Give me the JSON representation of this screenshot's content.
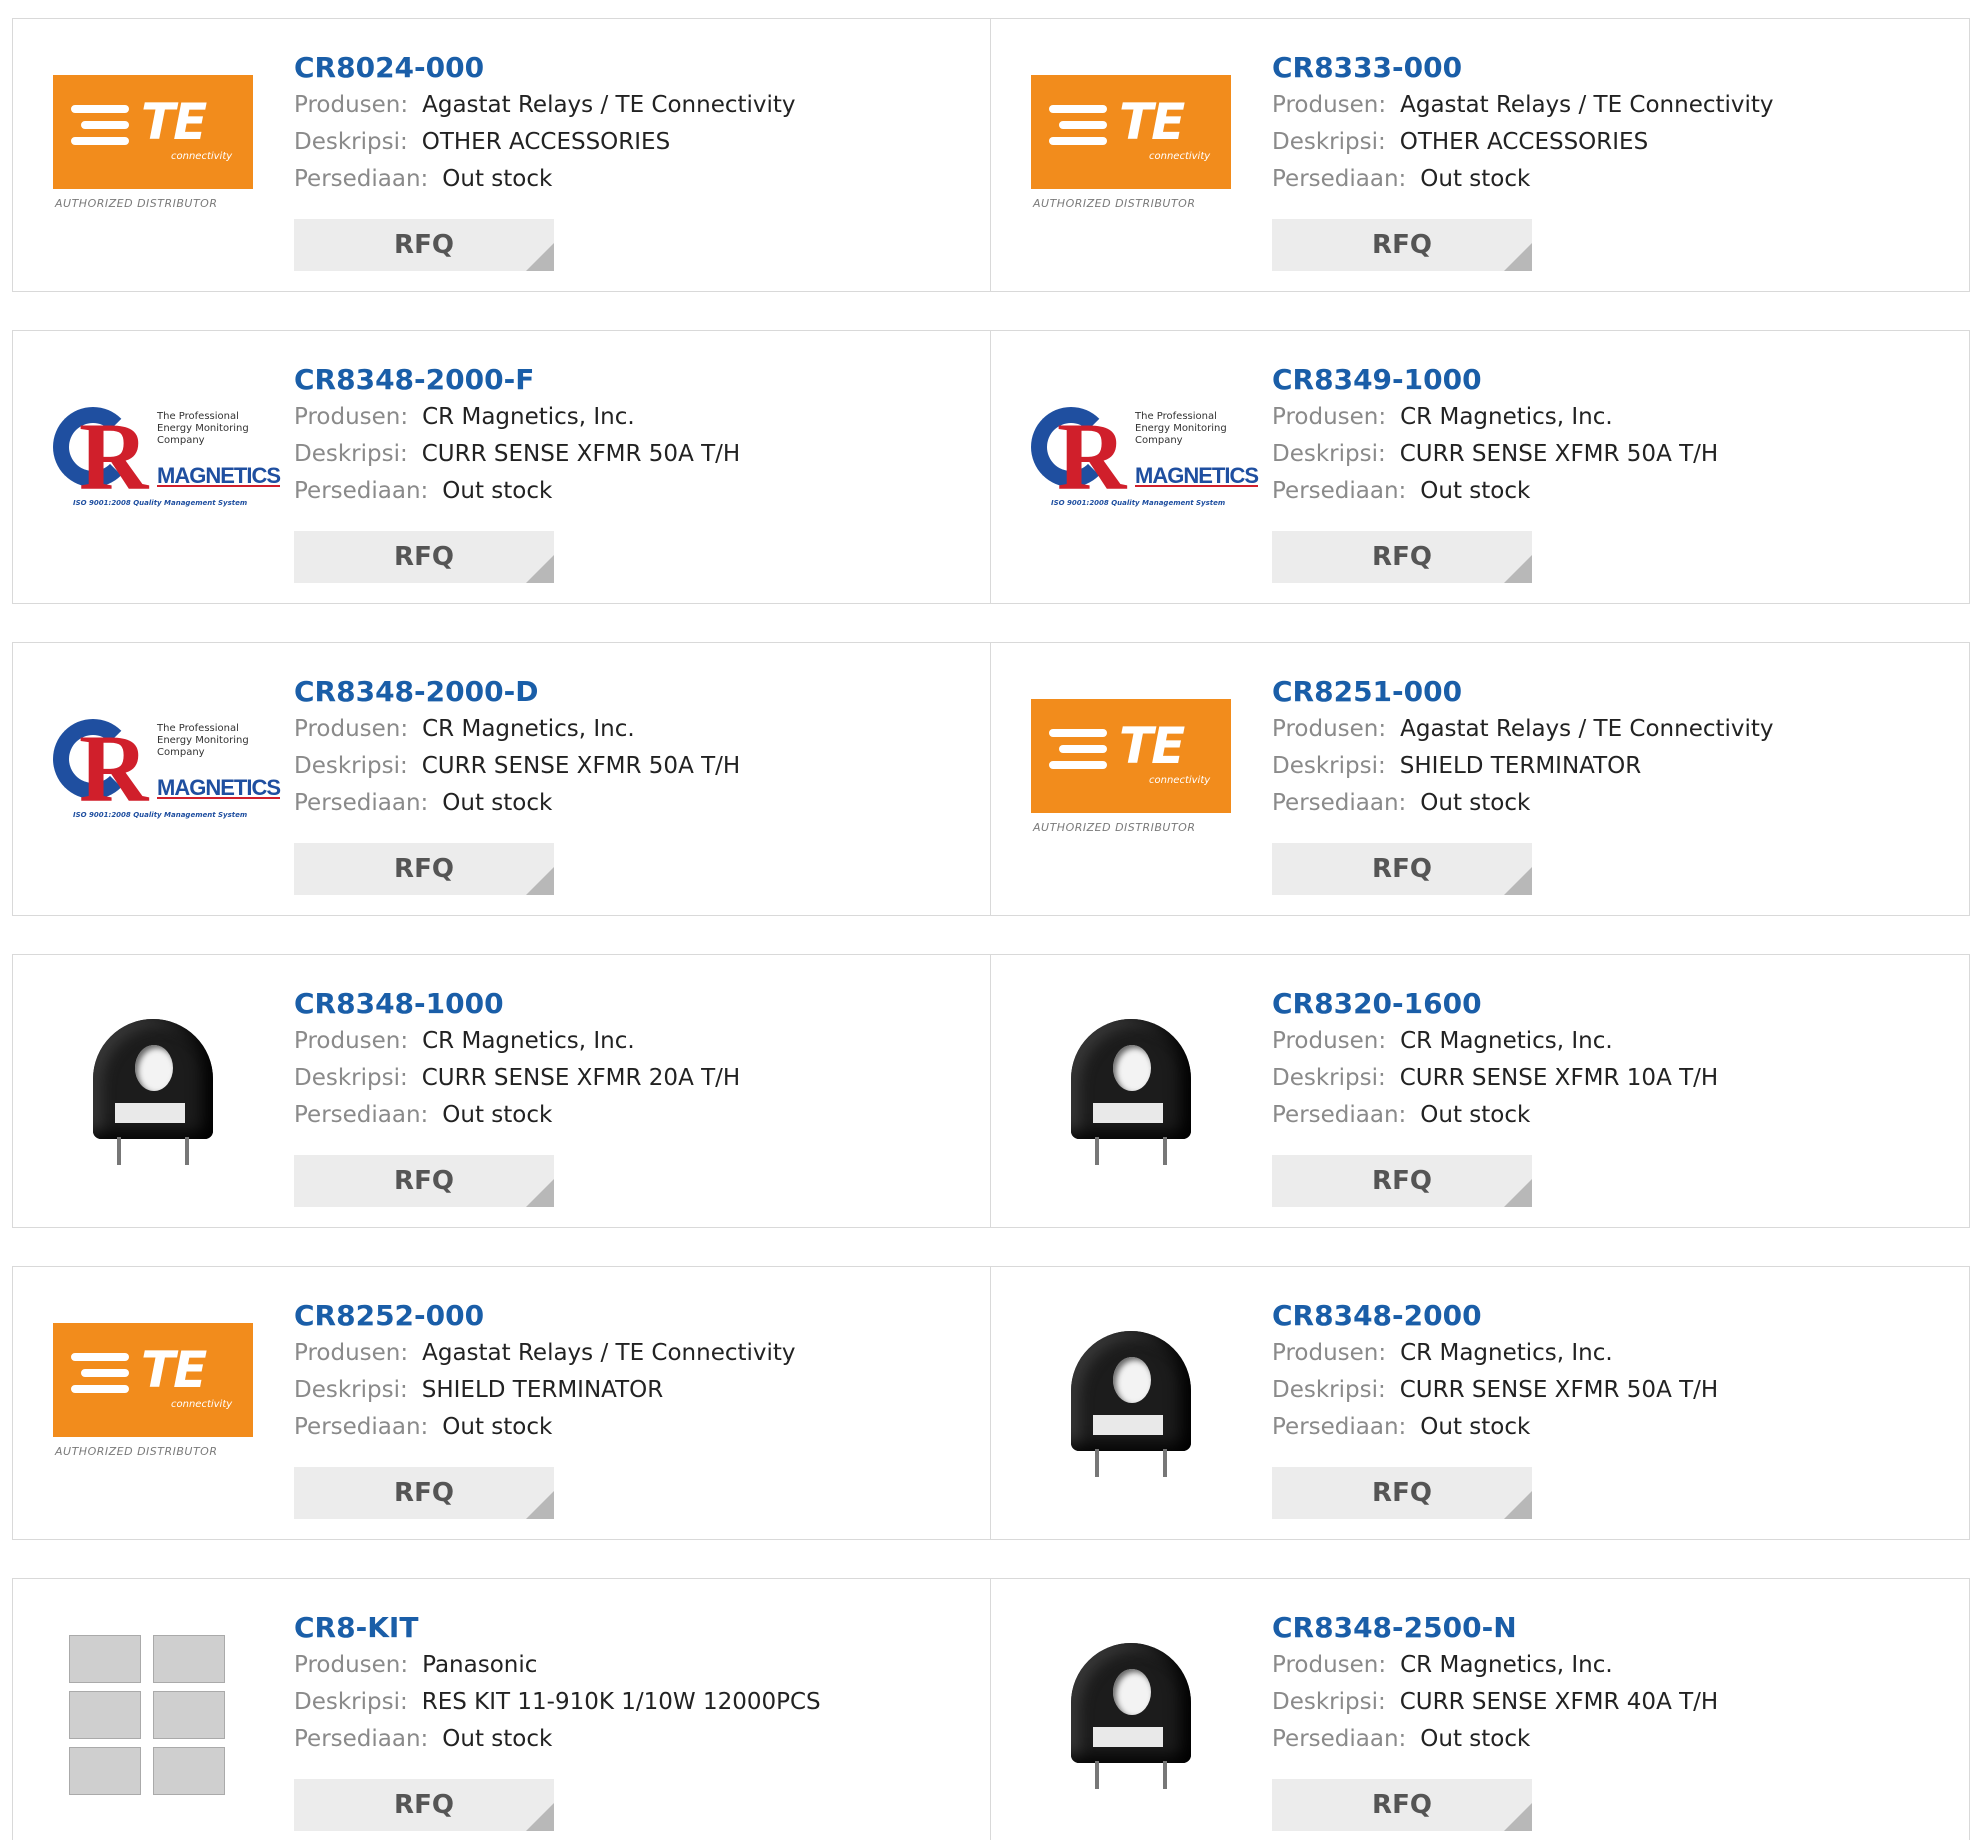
{
  "labels": {
    "manufacturer": "Produsen:",
    "description": "Deskripsi:",
    "stock": "Persediaan:",
    "rfq": "RFQ"
  },
  "colors": {
    "part_link": "#1a5ea8",
    "te_orange": "#f28c1c",
    "rfq_bg": "#ececec"
  },
  "products": [
    {
      "part": "CR8024-000",
      "manufacturer": "Agastat Relays / TE Connectivity",
      "description": "OTHER ACCESSORIES",
      "stock": "Out stock",
      "image": "te-logo"
    },
    {
      "part": "CR8333-000",
      "manufacturer": "Agastat Relays / TE Connectivity",
      "description": "OTHER ACCESSORIES",
      "stock": "Out stock",
      "image": "te-logo"
    },
    {
      "part": "CR8348-2000-F",
      "manufacturer": "CR Magnetics, Inc.",
      "description": "CURR SENSE XFMR 50A T/H",
      "stock": "Out stock",
      "image": "cr-magnetics-logo"
    },
    {
      "part": "CR8349-1000",
      "manufacturer": "CR Magnetics, Inc.",
      "description": "CURR SENSE XFMR 50A T/H",
      "stock": "Out stock",
      "image": "cr-magnetics-logo"
    },
    {
      "part": "CR8348-2000-D",
      "manufacturer": "CR Magnetics, Inc.",
      "description": "CURR SENSE XFMR 50A T/H",
      "stock": "Out stock",
      "image": "cr-magnetics-logo"
    },
    {
      "part": "CR8251-000",
      "manufacturer": "Agastat Relays / TE Connectivity",
      "description": "SHIELD TERMINATOR",
      "stock": "Out stock",
      "image": "te-logo"
    },
    {
      "part": "CR8348-1000",
      "manufacturer": "CR Magnetics, Inc.",
      "description": "CURR SENSE XFMR 20A T/H",
      "stock": "Out stock",
      "image": "transformer-photo"
    },
    {
      "part": "CR8320-1600",
      "manufacturer": "CR Magnetics, Inc.",
      "description": "CURR SENSE XFMR 10A T/H",
      "stock": "Out stock",
      "image": "transformer-photo"
    },
    {
      "part": "CR8252-000",
      "manufacturer": "Agastat Relays / TE Connectivity",
      "description": "SHIELD TERMINATOR",
      "stock": "Out stock",
      "image": "te-logo"
    },
    {
      "part": "CR8348-2000",
      "manufacturer": "CR Magnetics, Inc.",
      "description": "CURR SENSE XFMR 50A T/H",
      "stock": "Out stock",
      "image": "transformer-photo"
    },
    {
      "part": "CR8-KIT",
      "manufacturer": "Panasonic",
      "description": "RES KIT 11-910K 1/10W 12000PCS",
      "stock": "Out stock",
      "image": "resistor-kit-photo"
    },
    {
      "part": "CR8348-2500-N",
      "manufacturer": "CR Magnetics, Inc.",
      "description": "CURR SENSE XFMR 40A T/H",
      "stock": "Out stock",
      "image": "transformer-photo"
    }
  ],
  "logos": {
    "te": {
      "mark": "TE",
      "sub": "connectivity",
      "tagline": "AUTHORIZED DISTRIBUTOR"
    },
    "cr": {
      "mark": "R",
      "tag": "The Professional Energy Monitoring Company",
      "name": "MAGNETICS",
      "iso": "ISO 9001:2008 Quality Management System"
    }
  }
}
